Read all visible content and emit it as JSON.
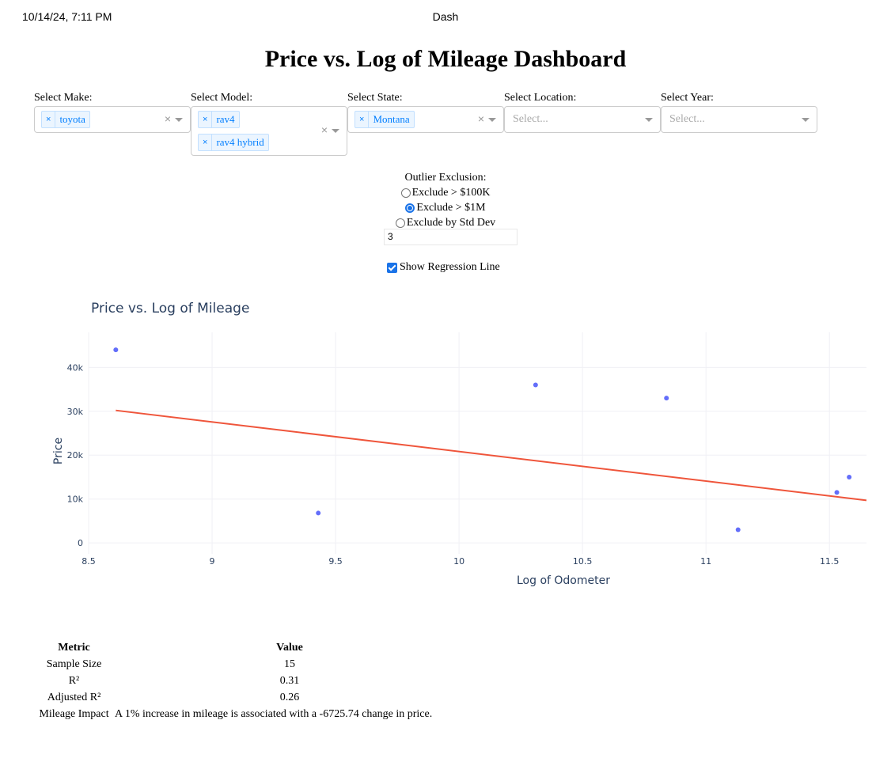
{
  "print_header": {
    "date": "10/14/24, 7:11 PM",
    "title": "Dash"
  },
  "page_title": "Price vs. Log of Mileage Dashboard",
  "filters": {
    "make": {
      "label": "Select Make:",
      "chips": [
        "toyota"
      ]
    },
    "model": {
      "label": "Select Model:",
      "chips": [
        "rav4",
        "rav4 hybrid"
      ]
    },
    "state": {
      "label": "Select State:",
      "chips": [
        "Montana"
      ]
    },
    "location": {
      "label": "Select Location:",
      "placeholder": "Select..."
    },
    "year": {
      "label": "Select Year:",
      "placeholder": "Select..."
    }
  },
  "outlier": {
    "title": "Outlier Exclusion:",
    "options": [
      "Exclude > $100K",
      "Exclude > $1M",
      "Exclude by Std Dev"
    ],
    "selected": "Exclude > $1M",
    "std_dev_value": "3"
  },
  "regression_toggle": {
    "label": "Show Regression Line",
    "checked": true
  },
  "chart_data": {
    "type": "scatter",
    "title": "Price vs. Log of Mileage",
    "xlabel": "Log of Odometer",
    "ylabel": "Price",
    "xlim": [
      8.5,
      11.65
    ],
    "ylim": [
      -2500,
      48000
    ],
    "x_ticks": [
      "8.5",
      "9",
      "9.5",
      "10",
      "10.5",
      "11",
      "11.5"
    ],
    "y_ticks": [
      "0",
      "10k",
      "20k",
      "30k",
      "40k"
    ],
    "series": [
      {
        "x": [
          8.61,
          9.43,
          10.31,
          10.84,
          11.13,
          11.53,
          11.58
        ],
        "y": [
          44000,
          6800,
          36000,
          33000,
          3000,
          11500,
          15000
        ],
        "color": "#636efa"
      }
    ],
    "regression": {
      "x": [
        8.61,
        11.65
      ],
      "y": [
        30200,
        9700
      ],
      "color": "#ef553b"
    },
    "grid": true
  },
  "metrics": {
    "headers": [
      "Metric",
      "Value"
    ],
    "rows": [
      [
        "Sample Size",
        "15"
      ],
      [
        "R²",
        "0.31"
      ],
      [
        "Adjusted R²",
        "0.26"
      ],
      [
        "Mileage Impact",
        "A 1% increase in mileage is associated with a -6725.74 change in price."
      ]
    ]
  }
}
